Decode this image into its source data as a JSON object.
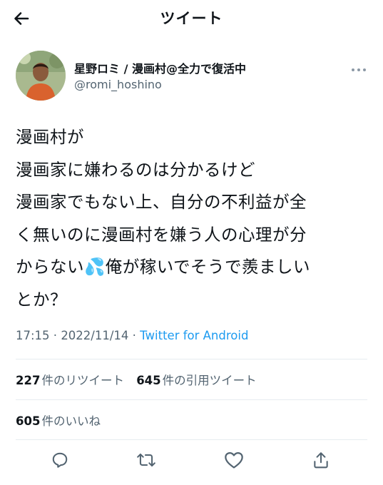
{
  "header": {
    "title": "ツイート",
    "back_icon": "arrow-left-icon"
  },
  "author": {
    "display_name": "星野ロミ / 漫画村@全力で復活中",
    "handle": "@romi_hoshino",
    "avatar_icon": "profile-photo",
    "more_icon": "more-dots-icon"
  },
  "tweet": {
    "text": "漫画村が\n漫画家に嫌わるのは分かるけど\n漫画家でもない上、自分の不利益が全\nく無いのに漫画村を嫌う人の心理が分\nからない💦俺が稼いでそうで羨ましい\nとか？"
  },
  "meta": {
    "time": "17:15",
    "separator1": " · ",
    "date": "2022/11/14",
    "separator2": " · ",
    "source": "Twitter for Android"
  },
  "stats": {
    "retweets": {
      "count": "227",
      "label": "件のリツイート"
    },
    "quotes": {
      "count": "645",
      "label": "件の引用ツイート"
    },
    "likes": {
      "count": "605",
      "label": "件のいいね"
    }
  },
  "actions": [
    {
      "icon": "reply-icon"
    },
    {
      "icon": "retweet-icon"
    },
    {
      "icon": "like-heart-icon"
    },
    {
      "icon": "share-icon"
    }
  ],
  "colors": {
    "accent": "#1d9bf0",
    "text": "#0f1419",
    "secondary": "#536471",
    "divider": "#e6ecf0"
  }
}
